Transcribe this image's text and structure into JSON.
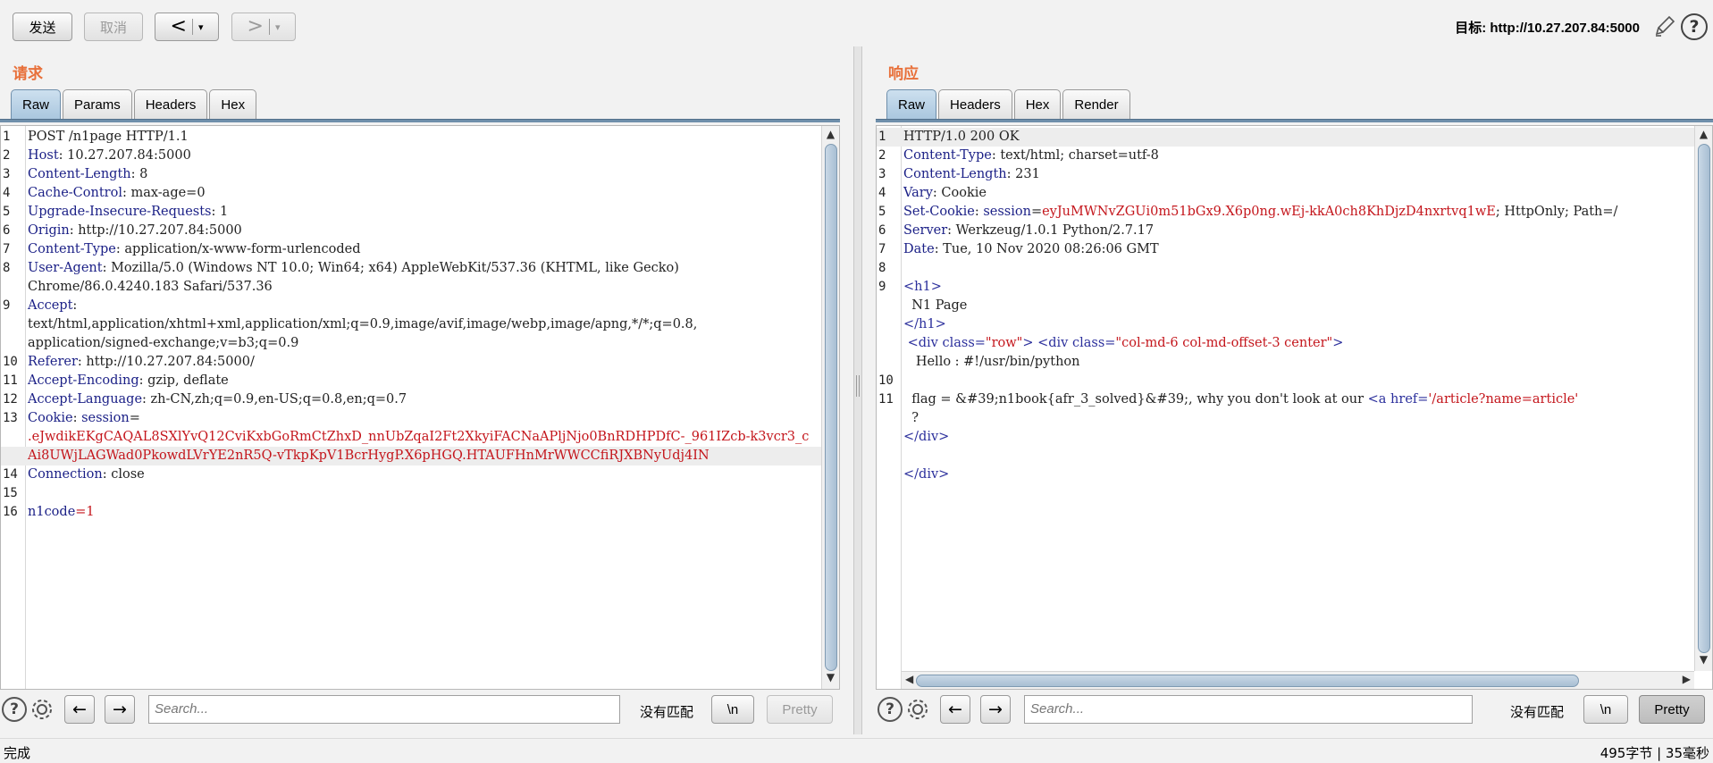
{
  "toolbar": {
    "send_label": "发送",
    "cancel_label": "取消",
    "back_symbol": "<",
    "forward_symbol": ">",
    "dropdown_symbol": "▾",
    "target_label": "目标: http://10.27.207.84:5000"
  },
  "request": {
    "title": "请求",
    "tabs": [
      "Raw",
      "Params",
      "Headers",
      "Hex"
    ],
    "active_tab": "Raw",
    "lines": [
      {
        "n": "1",
        "parts": [
          [
            "v",
            "POST /n1page HTTP/1.1"
          ]
        ]
      },
      {
        "n": "2",
        "parts": [
          [
            "k",
            "Host"
          ],
          [
            "v",
            ": 10.27.207.84:5000"
          ]
        ]
      },
      {
        "n": "3",
        "parts": [
          [
            "k",
            "Content-Length"
          ],
          [
            "v",
            ": 8"
          ]
        ]
      },
      {
        "n": "4",
        "parts": [
          [
            "k",
            "Cache-Control"
          ],
          [
            "v",
            ": max-age=0"
          ]
        ]
      },
      {
        "n": "5",
        "parts": [
          [
            "k",
            "Upgrade-Insecure-Requests"
          ],
          [
            "v",
            ": 1"
          ]
        ]
      },
      {
        "n": "6",
        "parts": [
          [
            "k",
            "Origin"
          ],
          [
            "v",
            ": http://10.27.207.84:5000"
          ]
        ]
      },
      {
        "n": "7",
        "parts": [
          [
            "k",
            "Content-Type"
          ],
          [
            "v",
            ": application/x-www-form-urlencoded"
          ]
        ]
      },
      {
        "n": "8",
        "parts": [
          [
            "k",
            "User-Agent"
          ],
          [
            "v",
            ": Mozilla/5.0 (Windows NT 10.0; Win64; x64) AppleWebKit/537.36 (KHTML, like Gecko)"
          ]
        ]
      },
      {
        "n": "",
        "parts": [
          [
            "v",
            "Chrome/86.0.4240.183 Safari/537.36"
          ]
        ]
      },
      {
        "n": "9",
        "parts": [
          [
            "k",
            "Accept"
          ],
          [
            "v",
            ":"
          ]
        ]
      },
      {
        "n": "",
        "parts": [
          [
            "v",
            "text/html,application/xhtml+xml,application/xml;q=0.9,image/avif,image/webp,image/apng,*/*;q=0.8,"
          ]
        ]
      },
      {
        "n": "",
        "parts": [
          [
            "v",
            "application/signed-exchange;v=b3;q=0.9"
          ]
        ]
      },
      {
        "n": "10",
        "parts": [
          [
            "k",
            "Referer"
          ],
          [
            "v",
            ": http://10.27.207.84:5000/"
          ]
        ]
      },
      {
        "n": "11",
        "parts": [
          [
            "k",
            "Accept-Encoding"
          ],
          [
            "v",
            ": gzip, deflate"
          ]
        ]
      },
      {
        "n": "12",
        "parts": [
          [
            "k",
            "Accept-Language"
          ],
          [
            "v",
            ": zh-CN,zh;q=0.9,en-US;q=0.8,en;q=0.7"
          ]
        ]
      },
      {
        "n": "13",
        "parts": [
          [
            "k",
            "Cookie"
          ],
          [
            "v",
            ": "
          ],
          [
            "k",
            "session"
          ],
          [
            "v",
            "="
          ]
        ]
      },
      {
        "n": "",
        "parts": [
          [
            "r",
            ".eJwdikEKgCAQAL8SXlYvQ12CviKxbGoRmCtZhxD_nnUbZqaI2Ft2XkyiFACNaAPljNjo0BnRDHPDfC-_961IZcb-k3vcr3_c"
          ]
        ]
      },
      {
        "n": "",
        "hl": true,
        "parts": [
          [
            "r",
            "Ai8UWjLAGWad0PkowdLVrYE2nR5Q-vTkpKpV1BcrHygP.X6pHGQ.HTAUFHnMrWWCCfiRJXBNyUdj4IN"
          ]
        ]
      },
      {
        "n": "14",
        "parts": [
          [
            "k",
            "Connection"
          ],
          [
            "v",
            ": close"
          ]
        ]
      },
      {
        "n": "15",
        "parts": [
          [
            "v",
            ""
          ]
        ]
      },
      {
        "n": "16",
        "parts": [
          [
            "k",
            "n1code"
          ],
          [
            "r",
            "=1"
          ]
        ]
      }
    ],
    "search_placeholder": "Search...",
    "no_match": "没有匹配",
    "newline_label": "\\n",
    "pretty_label": "Pretty"
  },
  "response": {
    "title": "响应",
    "tabs": [
      "Raw",
      "Headers",
      "Hex",
      "Render"
    ],
    "active_tab": "Raw",
    "lines": [
      {
        "n": "1",
        "hl": true,
        "parts": [
          [
            "v",
            "HTTP/1.0 200 OK"
          ]
        ]
      },
      {
        "n": "2",
        "parts": [
          [
            "k",
            "Content-Type"
          ],
          [
            "v",
            ": text/html; charset=utf-8"
          ]
        ]
      },
      {
        "n": "3",
        "parts": [
          [
            "k",
            "Content-Length"
          ],
          [
            "v",
            ": 231"
          ]
        ]
      },
      {
        "n": "4",
        "parts": [
          [
            "k",
            "Vary"
          ],
          [
            "v",
            ": Cookie"
          ]
        ]
      },
      {
        "n": "5",
        "parts": [
          [
            "k",
            "Set-Cookie"
          ],
          [
            "v",
            ": "
          ],
          [
            "k",
            "session"
          ],
          [
            "v",
            "="
          ],
          [
            "r",
            "eyJuMWNvZGUi0m51bGx9.X6p0ng.wEj-kkA0ch8KhDjzD4nxrtvq1wE"
          ],
          [
            "v",
            "; HttpOnly; Path=/"
          ]
        ]
      },
      {
        "n": "6",
        "parts": [
          [
            "k",
            "Server"
          ],
          [
            "v",
            ": Werkzeug/1.0.1 Python/2.7.17"
          ]
        ]
      },
      {
        "n": "7",
        "parts": [
          [
            "k",
            "Date"
          ],
          [
            "v",
            ": Tue, 10 Nov 2020 08:26:06 GMT"
          ]
        ]
      },
      {
        "n": "8",
        "parts": [
          [
            "v",
            ""
          ]
        ]
      },
      {
        "n": "9",
        "parts": [
          [
            "tag",
            "<h1>"
          ]
        ]
      },
      {
        "n": "",
        "parts": [
          [
            "v",
            "  N1 Page"
          ]
        ]
      },
      {
        "n": "",
        "parts": [
          [
            "tag",
            "</h1>"
          ]
        ]
      },
      {
        "n": "",
        "parts": [
          [
            "v",
            " "
          ],
          [
            "tag",
            "<div "
          ],
          [
            "attr",
            "class="
          ],
          [
            "aval",
            "\"row\""
          ],
          [
            "tag",
            "> <div "
          ],
          [
            "attr",
            "class="
          ],
          [
            "aval",
            "\"col-md-6 col-md-offset-3 center\""
          ],
          [
            "tag",
            ">"
          ]
        ]
      },
      {
        "n": "",
        "parts": [
          [
            "v",
            "   Hello : #!/usr/bin/python"
          ]
        ]
      },
      {
        "n": "10",
        "parts": [
          [
            "v",
            ""
          ]
        ]
      },
      {
        "n": "11",
        "parts": [
          [
            "v",
            "  flag = &#39;n1book{afr_3_solved}&#39;, why you don't look at our "
          ],
          [
            "tag",
            "<a "
          ],
          [
            "attr",
            "href="
          ],
          [
            "aval",
            "'/article?name=article'"
          ]
        ]
      },
      {
        "n": "",
        "parts": [
          [
            "v",
            "  ?"
          ]
        ]
      },
      {
        "n": "",
        "parts": [
          [
            "tag",
            "</div>"
          ]
        ]
      },
      {
        "n": "",
        "parts": [
          [
            "v",
            ""
          ]
        ]
      },
      {
        "n": "",
        "parts": [
          [
            "tag",
            "</div>"
          ]
        ]
      }
    ],
    "search_placeholder": "Search...",
    "no_match": "没有匹配",
    "newline_label": "\\n",
    "pretty_label": "Pretty"
  },
  "status": {
    "left": "完成",
    "right": "495字节 | 35毫秒"
  },
  "icons": [
    "edit-icon",
    "help-icon",
    "settings-icon",
    "arrow-left-icon",
    "arrow-right-icon"
  ]
}
